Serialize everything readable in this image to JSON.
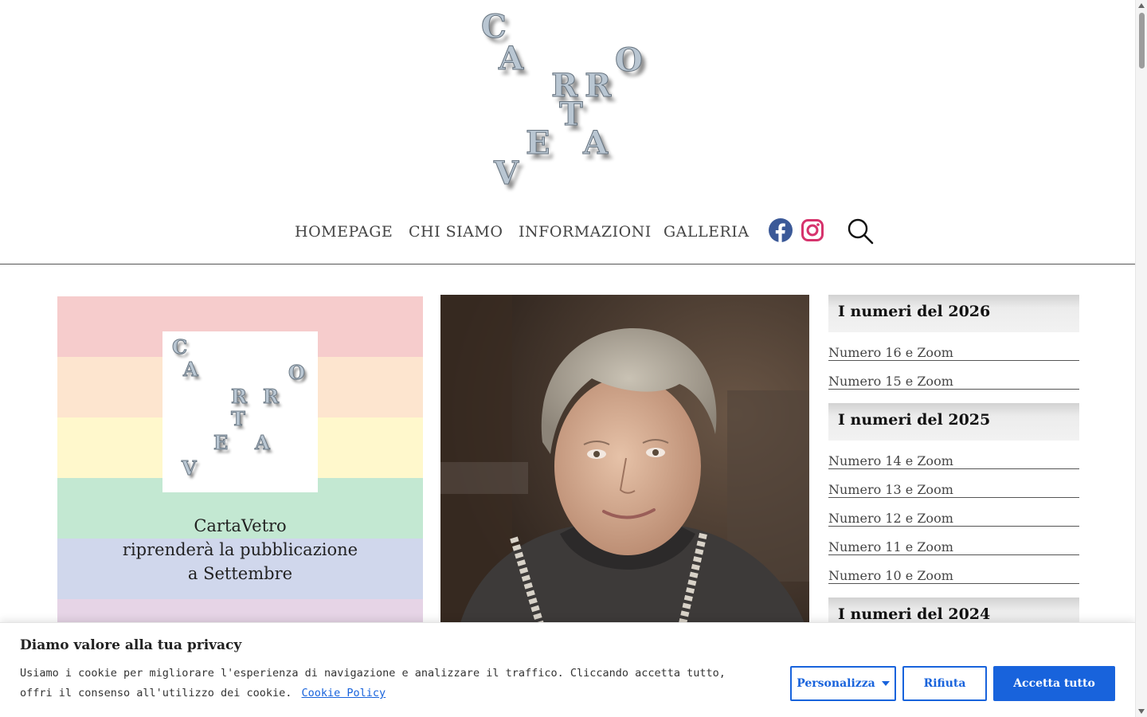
{
  "site": {
    "logo_letters": [
      "C",
      "A",
      "R",
      "R",
      "O",
      "T",
      "E",
      "A",
      "V"
    ]
  },
  "nav": {
    "items": [
      "HOMEPAGE",
      "CHI SIAMO",
      "INFORMAZIONI",
      "GALLERIA"
    ],
    "social": [
      {
        "name": "facebook-icon",
        "color": "#3b5998"
      },
      {
        "name": "instagram-icon",
        "color": "#d6336c"
      }
    ],
    "search_icon": "search-icon"
  },
  "featured": {
    "card1": {
      "logo_letters": [
        "C",
        "A",
        "R",
        "R",
        "O",
        "T",
        "E",
        "A",
        "V"
      ],
      "line1": "CartaVetro",
      "line2": "riprenderà la pubblicazione",
      "line3": "a Settembre",
      "stripes": [
        "#f6cccc",
        "#fde5cf",
        "#fff8cc",
        "#c3e8d2",
        "#d0d7ec",
        "#e6d4e6"
      ]
    },
    "card2": {
      "alt": "photo-portrait"
    }
  },
  "sidebar": {
    "sections": [
      {
        "title": "I numeri del 2026",
        "links": [
          "Numero 16 e Zoom",
          "Numero 15 e Zoom"
        ]
      },
      {
        "title": "I numeri del 2025",
        "links": [
          "Numero 14 e Zoom",
          "Numero 13 e Zoom",
          "Numero 12 e Zoom",
          "Numero 11 e Zoom",
          "Numero 10 e Zoom"
        ]
      },
      {
        "title": "I numeri del 2024",
        "links": []
      }
    ]
  },
  "cookie": {
    "title": "Diamo valore alla tua privacy",
    "text": "Usiamo i cookie per migliorare l'esperienza di navigazione e analizzare il traffico. Cliccando accetta tutto, offri il consenso all'utilizzo dei cookie.",
    "link": "Cookie Policy",
    "customize": "Personalizza",
    "reject": "Rifiuta",
    "accept": "Accetta tutto",
    "accent": "#1863dc"
  }
}
